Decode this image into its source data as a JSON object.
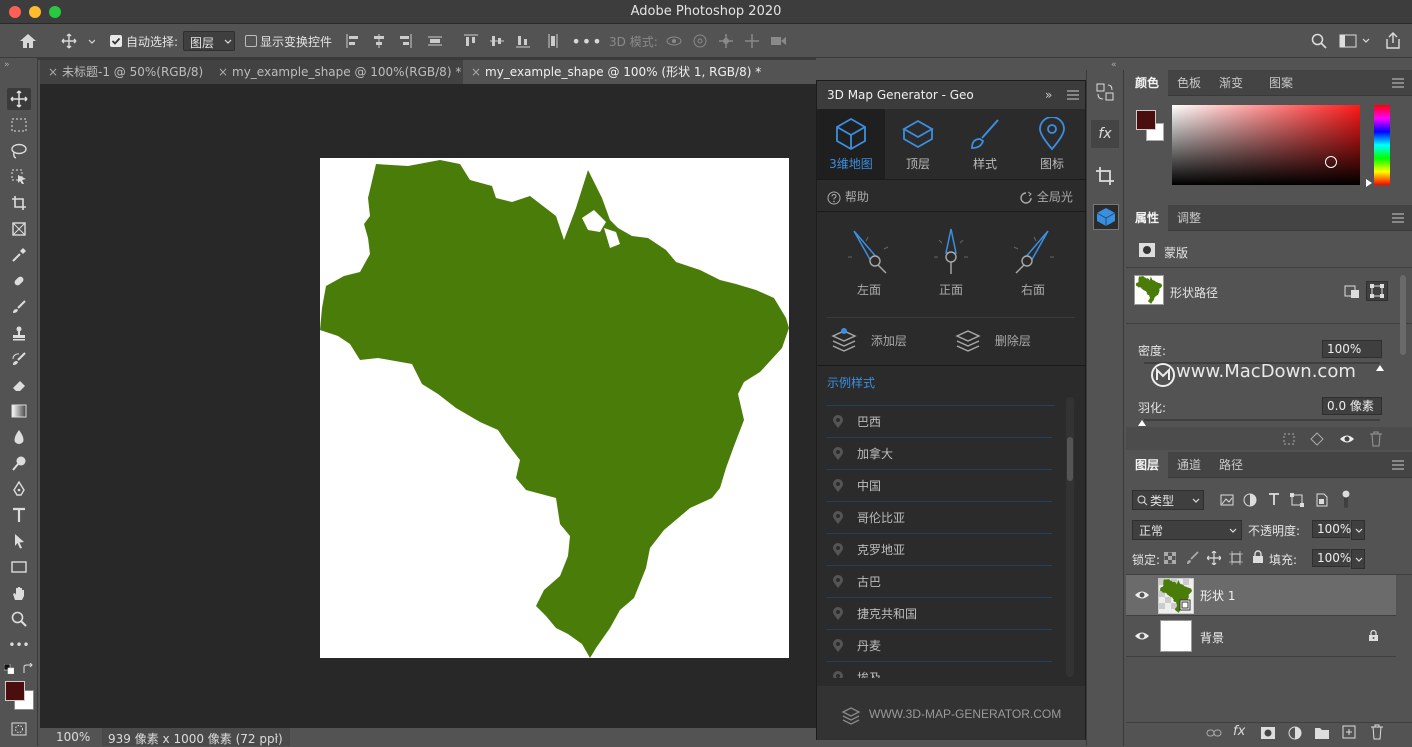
{
  "app": {
    "title": "Adobe Photoshop 2020"
  },
  "options_bar": {
    "auto_select_label": "自动选择:",
    "auto_select_value": "图层",
    "show_transform_label": "显示变换控件",
    "mode_3d_label": "3D 模式:"
  },
  "tabs": [
    {
      "label": "未标题-1 @ 50%(RGB/8)",
      "active": false
    },
    {
      "label": "my_example_shape @ 100%(RGB/8) *",
      "active": false
    },
    {
      "label": "my_example_shape @ 100% (形状 1, RGB/8) *",
      "active": true
    }
  ],
  "status": {
    "zoom": "100%",
    "doc_info": "939 像素 x 1000 像素 (72 ppi)"
  },
  "canvas": {
    "shape_color": "#4a7c0a",
    "background": "#ffffff"
  },
  "plugin": {
    "title": "3D Map Generator - Geo",
    "tabs": [
      {
        "label": "3维地图",
        "icon": "cube-icon",
        "active": true
      },
      {
        "label": "顶层",
        "icon": "layer-box-icon",
        "active": false
      },
      {
        "label": "样式",
        "icon": "brush-icon",
        "active": false
      },
      {
        "label": "图标",
        "icon": "map-pin-icon",
        "active": false
      }
    ],
    "help_label": "帮助",
    "global_light_label": "全局光",
    "views": [
      {
        "label": "左面",
        "icon": "compass-left-icon"
      },
      {
        "label": "正面",
        "icon": "compass-front-icon"
      },
      {
        "label": "右面",
        "icon": "compass-right-icon"
      }
    ],
    "add_layer_label": "添加层",
    "delete_layer_label": "删除层",
    "examples_title": "示例样式",
    "examples": [
      "巴西",
      "加拿大",
      "中国",
      "哥伦比亚",
      "克罗地亚",
      "古巴",
      "捷克共和国",
      "丹麦",
      "埃及"
    ],
    "footer_url": "WWW.3D-MAP-GENERATOR.COM",
    "accent": "#3b8fe0"
  },
  "color_panel": {
    "tabs": [
      "颜色",
      "色板",
      "渐变",
      "图案"
    ],
    "foreground": "#4a0e0e",
    "background": "#ffffff"
  },
  "properties_panel": {
    "tabs": [
      "属性",
      "调整"
    ],
    "mask_label": "蒙版",
    "shape_path_label": "形状路径",
    "density_label": "密度:",
    "density_value": "100%",
    "feather_label": "羽化:",
    "feather_value": "0.0 像素",
    "watermark": "www.MacDown.com"
  },
  "layers_panel": {
    "tabs": [
      "图层",
      "通道",
      "路径"
    ],
    "filter_label": "类型",
    "blend_mode": "正常",
    "opacity_label": "不透明度:",
    "opacity_value": "100%",
    "lock_label": "锁定:",
    "fill_label": "填充:",
    "fill_value": "100%",
    "layers": [
      {
        "name": "形状 1",
        "selected": true
      },
      {
        "name": "背景",
        "selected": false,
        "locked": true
      }
    ]
  }
}
